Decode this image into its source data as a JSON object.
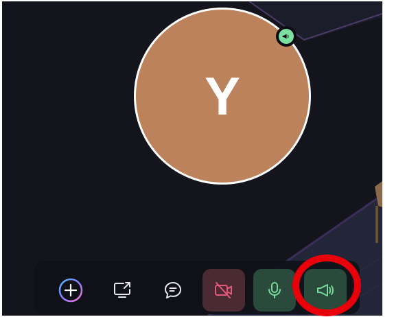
{
  "participant": {
    "initial": "Y",
    "avatar_color": "#bc825c",
    "speaking_indicator_color": "#7ddfa0",
    "speaking_icon": "megaphone-icon"
  },
  "toolbar": {
    "buttons": [
      {
        "id": "add",
        "icon": "plus-icon"
      },
      {
        "id": "share-screen",
        "icon": "screen-share-icon"
      },
      {
        "id": "chat",
        "icon": "chat-icon"
      },
      {
        "id": "camera",
        "icon": "camera-off-icon",
        "state": "off",
        "bg": "#4a2a33",
        "color": "#e55b7a"
      },
      {
        "id": "microphone",
        "icon": "microphone-icon",
        "state": "on",
        "bg": "#2a4a3b",
        "color": "#76d99a"
      },
      {
        "id": "megaphone",
        "icon": "megaphone-icon",
        "state": "on",
        "bg": "#2a4a3b",
        "color": "#76d99a"
      }
    ]
  },
  "colors": {
    "scene_bg": "#13141c",
    "highlight": "#e8000b",
    "toolbar_icon": "#e8e8ee"
  }
}
